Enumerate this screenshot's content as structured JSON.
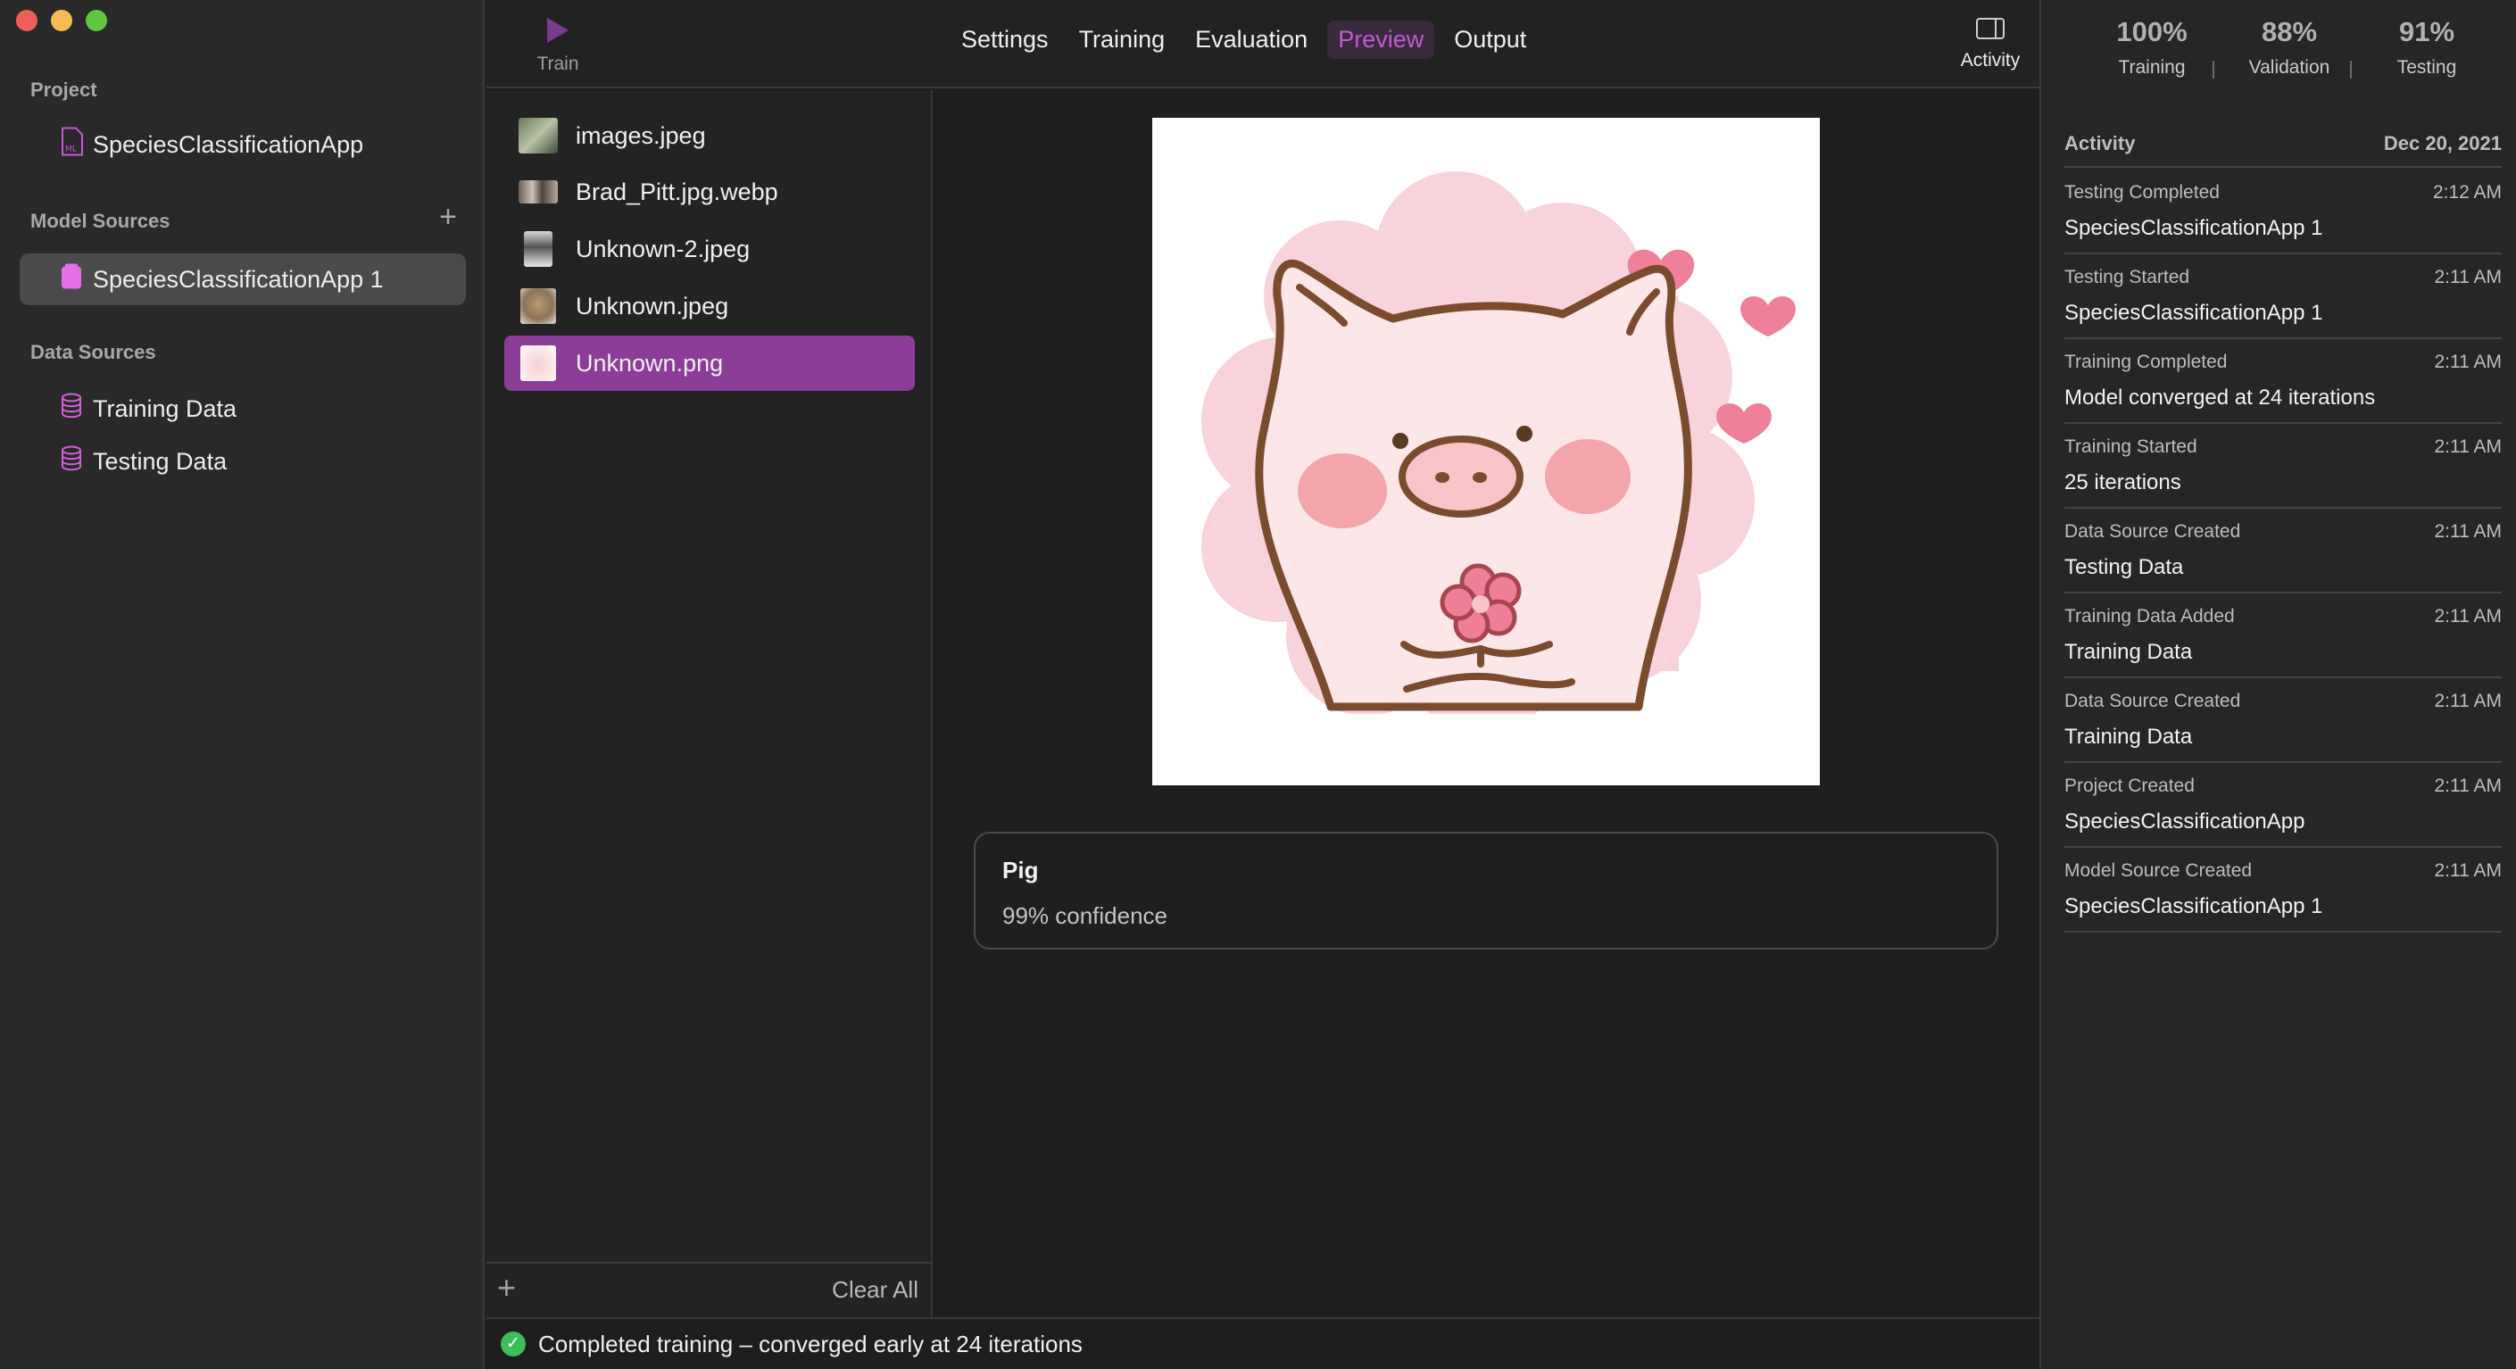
{
  "sidebar": {
    "project_heading": "Project",
    "project_name": "SpeciesClassificationApp",
    "model_sources_heading": "Model Sources",
    "model_source": "SpeciesClassificationApp 1",
    "data_sources_heading": "Data Sources",
    "data_sources": [
      "Training Data",
      "Testing Data"
    ]
  },
  "toolbar": {
    "train_label": "Train",
    "tabs": [
      "Settings",
      "Training",
      "Evaluation",
      "Preview",
      "Output"
    ],
    "active_tab": "Preview",
    "activity_label": "Activity"
  },
  "files": {
    "items": [
      "images.jpeg",
      "Brad_Pitt.jpg.webp",
      "Unknown-2.jpeg",
      "Unknown.jpeg",
      "Unknown.png"
    ],
    "selected": "Unknown.png",
    "clear_label": "Clear All"
  },
  "result": {
    "class": "Pig",
    "confidence": "99% confidence"
  },
  "status": {
    "text": "Completed training – converged early at 24 iterations"
  },
  "metrics": [
    {
      "value": "100%",
      "label": "Training"
    },
    {
      "value": "88%",
      "label": "Validation"
    },
    {
      "value": "91%",
      "label": "Testing"
    }
  ],
  "activity": {
    "heading": "Activity",
    "date": "Dec 20, 2021",
    "items": [
      {
        "event": "Testing Completed",
        "time": "2:12 AM",
        "detail": "SpeciesClassificationApp 1"
      },
      {
        "event": "Testing Started",
        "time": "2:11 AM",
        "detail": "SpeciesClassificationApp 1"
      },
      {
        "event": "Training Completed",
        "time": "2:11 AM",
        "detail": "Model converged at 24 iterations"
      },
      {
        "event": "Training Started",
        "time": "2:11 AM",
        "detail": "25 iterations"
      },
      {
        "event": "Data Source Created",
        "time": "2:11 AM",
        "detail": "Testing Data"
      },
      {
        "event": "Training Data Added",
        "time": "2:11 AM",
        "detail": "Training Data"
      },
      {
        "event": "Data Source Created",
        "time": "2:11 AM",
        "detail": "Training Data"
      },
      {
        "event": "Project Created",
        "time": "2:11 AM",
        "detail": "SpeciesClassificationApp"
      },
      {
        "event": "Model Source Created",
        "time": "2:11 AM",
        "detail": "SpeciesClassificationApp 1"
      }
    ]
  },
  "colors": {
    "accent": "#8a3e98",
    "active_tab_text": "#c25ad0",
    "success": "#3cbe5a"
  }
}
